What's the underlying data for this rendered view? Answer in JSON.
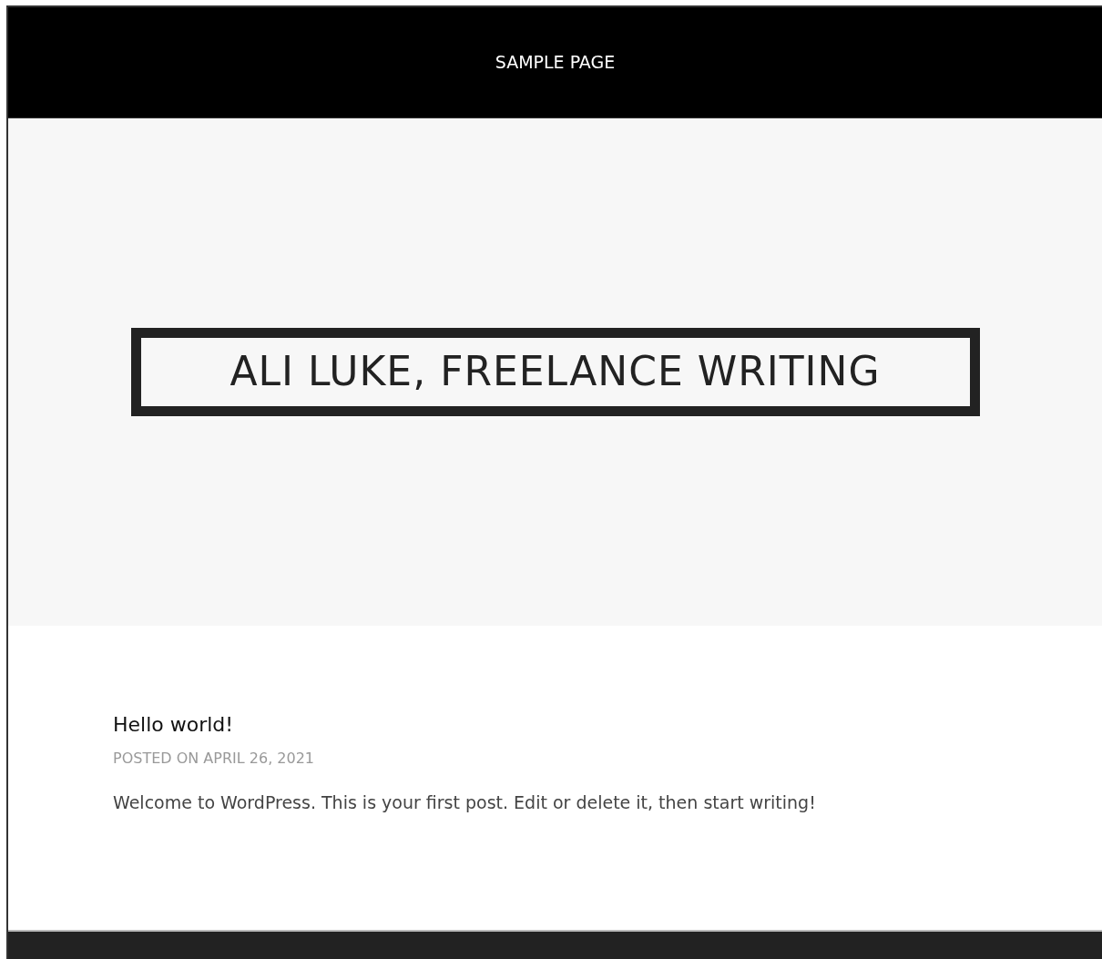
{
  "menu": [
    {
      "label": "SAMPLE PAGE"
    }
  ],
  "site_title": "ALI LUKE, FREELANCE WRITING",
  "posts": [
    {
      "title": "Hello world!",
      "meta": "POSTED ON APRIL 26, 2021",
      "excerpt": "Welcome to WordPress. This is your first post. Edit or delete it, then start writing!"
    }
  ]
}
